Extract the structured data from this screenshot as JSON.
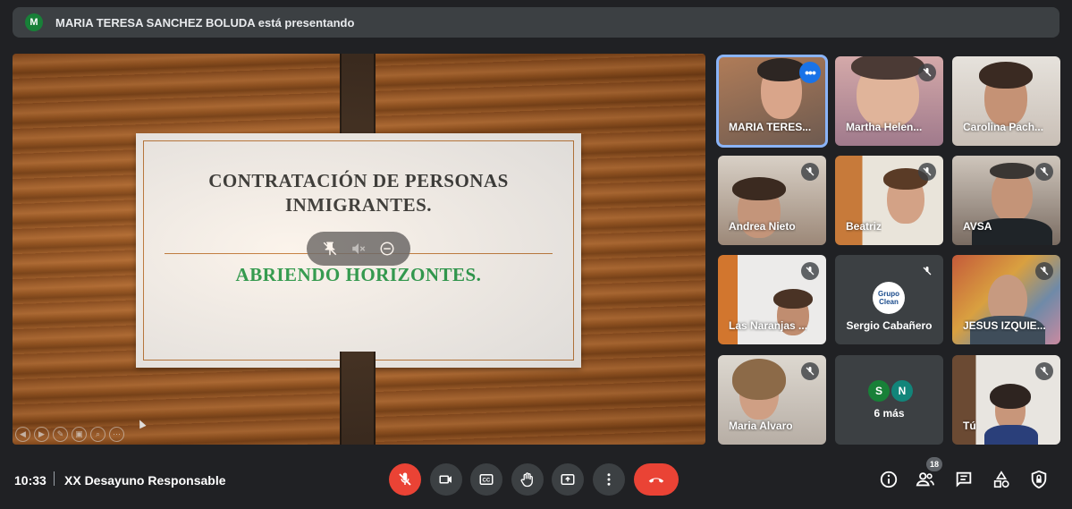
{
  "presenting_bar": {
    "avatar_letter": "M",
    "text": "MARIA TERESA SANCHEZ BOLUDA está presentando"
  },
  "slide": {
    "title_line1": "CONTRATACIÓN DE PERSONAS",
    "title_line2": "INMIGRANTES.",
    "subtitle": "ABRIENDO HORIZONTES.",
    "title_color": "#2f3437",
    "subtitle_color": "#1e9a4c"
  },
  "participants": [
    {
      "name": "MARIA TERES...",
      "muted": false,
      "active": true
    },
    {
      "name": "Martha Helen...",
      "muted": true
    },
    {
      "name": "Carolina Pach...",
      "muted": false
    },
    {
      "name": "Andrea Nieto",
      "muted": true
    },
    {
      "name": "Beatriz",
      "muted": true
    },
    {
      "name": "AVSA",
      "muted": true
    },
    {
      "name": "Las Naranjas ...",
      "muted": true
    },
    {
      "name": "Sergio Cabañero",
      "muted": true,
      "logo_text": "Grupo Clean"
    },
    {
      "name": "JESUS IZQUIE...",
      "muted": true
    },
    {
      "name": "Maria Alvaro",
      "muted": true
    },
    {
      "name": "Tú",
      "muted": true
    }
  ],
  "more_tile": {
    "avatars": [
      "S",
      "N"
    ],
    "label": "6 más"
  },
  "bottom": {
    "time": "10:33",
    "separator": "|",
    "meeting_name": "XX Desayuno Responsable",
    "participant_count": "18"
  },
  "colors": {
    "background": "#202124",
    "accent_blue": "#8ab4f8",
    "red": "#ea4335",
    "avatar_green": "#188038"
  }
}
